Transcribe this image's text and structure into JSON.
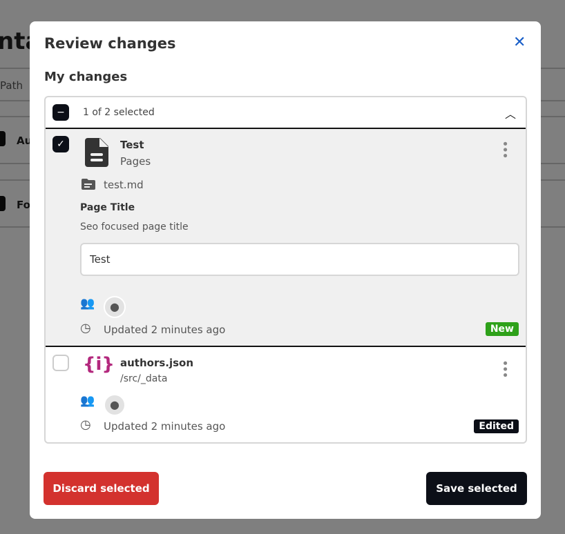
{
  "background": {
    "title_fragment": "nta",
    "column": "Path",
    "rows": [
      "Au",
      "Fo"
    ]
  },
  "modal": {
    "title": "Review changes",
    "section": "My changes",
    "selection": "1 of 2 selected",
    "items": [
      {
        "name": "Test",
        "collection": "Pages",
        "file": "test.md",
        "field_label": "Page Title",
        "field_hint": "Seo focused page title",
        "field_value": "Test",
        "updated": "Updated 2 minutes ago",
        "status": "New",
        "status_color": "#2ea11a",
        "checked": true
      },
      {
        "name": "authors.json",
        "collection": "/src/_data",
        "updated": "Updated 2 minutes ago",
        "status": "Edited",
        "status_color": "#0c0f17",
        "checked": false
      }
    ],
    "discard_label": "Discard selected",
    "save_label": "Save selected"
  },
  "colors": {
    "discard": "#d3322e",
    "save": "#0c0f17",
    "json_icon": "#b3287d"
  }
}
